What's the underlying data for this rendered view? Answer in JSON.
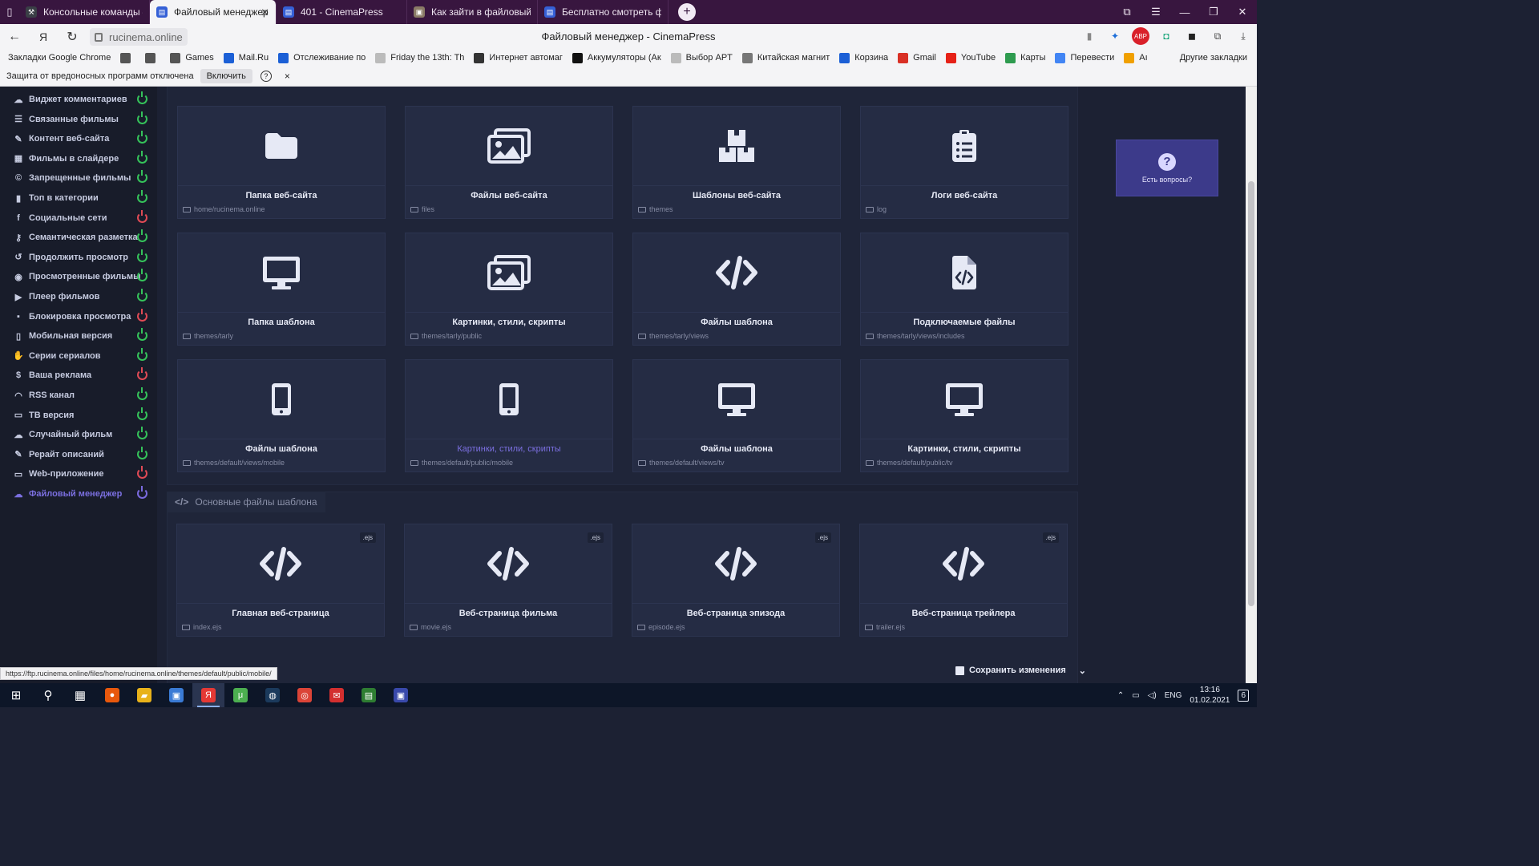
{
  "browser": {
    "tabs": [
      {
        "title": "Консольные команды — Г",
        "active": false,
        "color": "#3a3f46",
        "glyph": "⚒"
      },
      {
        "title": "Файловый менеджер - C",
        "active": true,
        "color": "#3560d6",
        "glyph": "▤"
      },
      {
        "title": "401 - CinemaPress",
        "active": false,
        "color": "#3560d6",
        "glyph": "▤"
      },
      {
        "title": "Как зайти в файловый ме",
        "active": false,
        "color": "#8a7b66",
        "glyph": "▣"
      },
      {
        "title": "Бесплатно смотреть филь",
        "active": false,
        "color": "#3560d6",
        "glyph": "▤"
      }
    ],
    "url": "rucinema.online",
    "page_title": "Файловый менеджер - CinemaPress",
    "bookmarks": [
      {
        "label": "Закладки Google Chrome",
        "color": "transparent"
      },
      {
        "label": "",
        "color": "#555"
      },
      {
        "label": "",
        "color": "#555"
      },
      {
        "label": "Games",
        "color": "#555"
      },
      {
        "label": "Mail.Ru",
        "color": "#1b5fd6"
      },
      {
        "label": "Отслеживание по",
        "color": "#1b5fd6"
      },
      {
        "label": "Friday the 13th: Th",
        "color": "transparent"
      },
      {
        "label": "Интернет автомаг",
        "color": "#333"
      },
      {
        "label": "Аккумуляторы (Ак",
        "color": "#111"
      },
      {
        "label": "Выбор APT",
        "color": "transparent"
      },
      {
        "label": "Китайская магнит",
        "color": "#777"
      },
      {
        "label": "Корзина",
        "color": "#1b5fd6"
      },
      {
        "label": "Gmail",
        "color": "#d93025"
      },
      {
        "label": "YouTube",
        "color": "#e62117"
      },
      {
        "label": "Карты",
        "color": "#2e9b4f"
      },
      {
        "label": "Перевести",
        "color": "#4285f4"
      },
      {
        "label": "Aı",
        "color": "#f0a000"
      }
    ],
    "bookmarks_other": "Другие закладки",
    "infobar": {
      "text": "Защита от вредоносных программ отключена",
      "button": "Включить",
      "help": "?",
      "close": "×"
    }
  },
  "sidebar": {
    "items": [
      {
        "label": "Виджет комментариев",
        "icon": "comments-icon",
        "glyph": "☁",
        "status": "on"
      },
      {
        "label": "Связанные фильмы",
        "icon": "list-icon",
        "glyph": "☰",
        "status": "on"
      },
      {
        "label": "Контент веб-сайта",
        "icon": "pen-icon",
        "glyph": "✎",
        "status": "on"
      },
      {
        "label": "Фильмы в слайдере",
        "icon": "film-icon",
        "glyph": "▦",
        "status": "on"
      },
      {
        "label": "Запрещенные фильмы",
        "icon": "copyright-icon",
        "glyph": "©",
        "status": "on"
      },
      {
        "label": "Топ в категории",
        "icon": "chart-icon",
        "glyph": "▮",
        "status": "on"
      },
      {
        "label": "Социальные сети",
        "icon": "facebook-icon",
        "glyph": "f",
        "status": "off"
      },
      {
        "label": "Семантическая разметка",
        "icon": "key-icon",
        "glyph": "⚷",
        "status": "on"
      },
      {
        "label": "Продолжить просмотр",
        "icon": "history-icon",
        "glyph": "↺",
        "status": "on"
      },
      {
        "label": "Просмотренные фильмы",
        "icon": "eye-icon",
        "glyph": "◉",
        "status": "on"
      },
      {
        "label": "Плеер фильмов",
        "icon": "play-icon",
        "glyph": "▶",
        "status": "on"
      },
      {
        "label": "Блокировка просмотра",
        "icon": "lock-icon",
        "glyph": "▪",
        "status": "off"
      },
      {
        "label": "Мобильная версия",
        "icon": "mobile-icon",
        "glyph": "▯",
        "status": "on"
      },
      {
        "label": "Серии сериалов",
        "icon": "hand-icon",
        "glyph": "✋",
        "status": "on"
      },
      {
        "label": "Ваша реклама",
        "icon": "dollar-icon",
        "glyph": "$",
        "status": "off"
      },
      {
        "label": "RSS канал",
        "icon": "rss-icon",
        "glyph": "◠",
        "status": "on"
      },
      {
        "label": "ТВ версия",
        "icon": "tv-icon",
        "glyph": "▭",
        "status": "on"
      },
      {
        "label": "Случайный фильм",
        "icon": "random-icon",
        "glyph": "☁",
        "status": "on"
      },
      {
        "label": "Рерайт описаний",
        "icon": "edit-icon",
        "glyph": "✎",
        "status": "on"
      },
      {
        "label": "Web-приложение",
        "icon": "desktop-icon",
        "glyph": "▭",
        "status": "off"
      },
      {
        "label": "Файловый менеджер",
        "icon": "cloud-icon",
        "glyph": "☁",
        "status": "current"
      }
    ]
  },
  "panel1": {
    "cards": [
      {
        "title": "Папка веб-сайта",
        "path": "home/rucinema.online",
        "icon": "folder-icon"
      },
      {
        "title": "Файлы веб-сайта",
        "path": "files",
        "icon": "images-icon"
      },
      {
        "title": "Шаблоны веб-сайта",
        "path": "themes",
        "icon": "boxes-icon"
      },
      {
        "title": "Логи веб-сайта",
        "path": "log",
        "icon": "clipboard-icon"
      },
      {
        "title": "Папка шаблона",
        "path": "themes/tarly",
        "icon": "desktop-icon"
      },
      {
        "title": "Картинки, стили, скрипты",
        "path": "themes/tarly/public",
        "icon": "images-icon"
      },
      {
        "title": "Файлы шаблона",
        "path": "themes/tarly/views",
        "icon": "code-icon"
      },
      {
        "title": "Подключаемые файлы",
        "path": "themes/tarly/views/includes",
        "icon": "file-code-icon"
      },
      {
        "title": "Файлы шаблона",
        "path": "themes/default/views/mobile",
        "icon": "mobile-icon"
      },
      {
        "title": "Картинки, стили, скрипты",
        "path": "themes/default/public/mobile",
        "icon": "mobile-icon",
        "highlight": true
      },
      {
        "title": "Файлы шаблона",
        "path": "themes/default/views/tv",
        "icon": "desktop-icon"
      },
      {
        "title": "Картинки, стили, скрипты",
        "path": "themes/default/public/tv",
        "icon": "desktop-icon"
      }
    ]
  },
  "panel2": {
    "heading": "Основные файлы шаблона",
    "cards": [
      {
        "title": "Главная веб-страница",
        "path": "index.ejs",
        "ext": ".ejs",
        "icon": "code-icon"
      },
      {
        "title": "Веб-страница фильма",
        "path": "movie.ejs",
        "ext": ".ejs",
        "icon": "code-icon"
      },
      {
        "title": "Веб-страница эпизода",
        "path": "episode.ejs",
        "ext": ".ejs",
        "icon": "code-icon"
      },
      {
        "title": "Веб-страница трейлера",
        "path": "trailer.ejs",
        "ext": ".ejs",
        "icon": "code-icon"
      }
    ]
  },
  "help_box": {
    "label": "Есть вопросы?",
    "glyph": "?"
  },
  "status_url": "https://ftp.rucinema.online/files/home/rucinema.online/themes/default/public/mobile/",
  "save_label": "Сохранить изменения",
  "taskbar": {
    "apps": [
      {
        "name": "windows-start-icon",
        "color": "transparent",
        "glyph": "⊞"
      },
      {
        "name": "search-icon",
        "color": "transparent",
        "glyph": "⚲"
      },
      {
        "name": "task-view-icon",
        "color": "transparent",
        "glyph": "▦"
      },
      {
        "name": "app-orange-icon",
        "color": "#e8580c",
        "glyph": "●"
      },
      {
        "name": "file-explorer-icon",
        "color": "#e8b21a",
        "glyph": "▰"
      },
      {
        "name": "store-icon",
        "color": "#3a7bd5",
        "glyph": "▣"
      },
      {
        "name": "yandex-browser-icon",
        "color": "#e53935",
        "glyph": "Я",
        "active": true
      },
      {
        "name": "utorrent-icon",
        "color": "#4caf50",
        "glyph": "μ"
      },
      {
        "name": "steam-icon",
        "color": "#1b3a5c",
        "glyph": "◍"
      },
      {
        "name": "chrome-icon",
        "color": "#db4437",
        "glyph": "◎"
      },
      {
        "name": "mail-icon",
        "color": "#d32f2f",
        "glyph": "✉"
      },
      {
        "name": "spreadsheet-icon",
        "color": "#2e7d32",
        "glyph": "▤"
      },
      {
        "name": "app-window-icon",
        "color": "#3949ab",
        "glyph": "▣"
      }
    ],
    "lang": "ENG",
    "time": "13:16",
    "date": "01.02.2021",
    "notifications": "6"
  }
}
